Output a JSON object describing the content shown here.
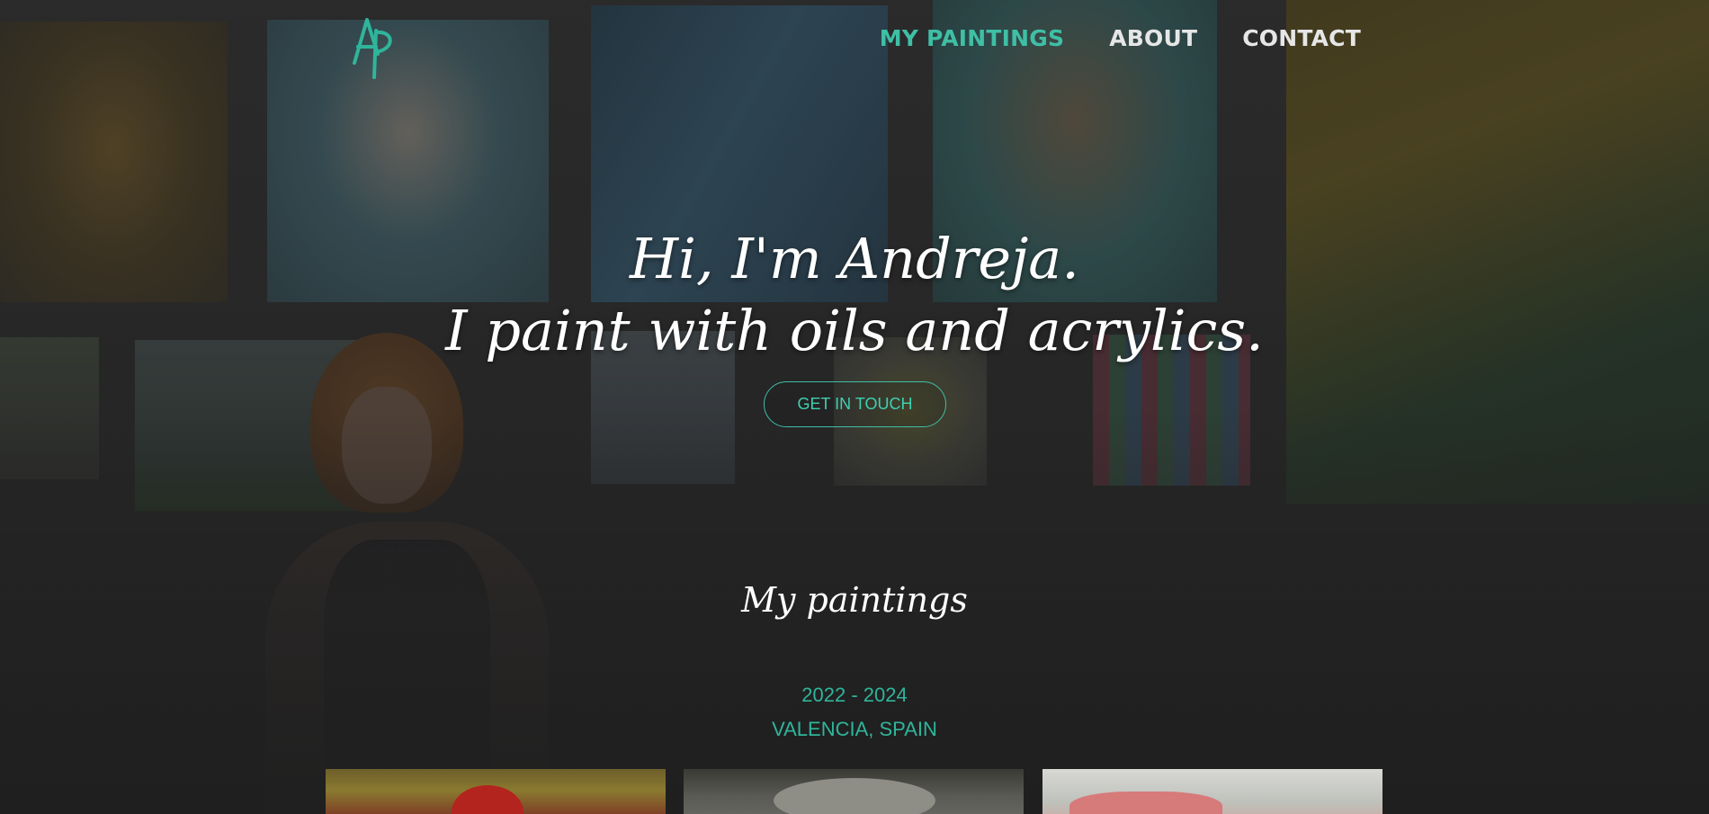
{
  "nav": {
    "items": [
      {
        "label": "MY PAINTINGS",
        "active": true
      },
      {
        "label": "ABOUT",
        "active": false
      },
      {
        "label": "CONTACT",
        "active": false
      }
    ]
  },
  "hero": {
    "line1": "Hi, I'm Andreja.",
    "line2": "I paint with oils and acrylics.",
    "cta_label": "GET IN TOUCH"
  },
  "section": {
    "title": "My paintings",
    "years": "2022 - 2024",
    "place": "VALENCIA, SPAIN"
  },
  "colors": {
    "accent": "#3fbfa5",
    "background": "#1f1f1f",
    "text": "#ffffff"
  },
  "icons": {
    "logo": "ap-monogram-logo"
  }
}
